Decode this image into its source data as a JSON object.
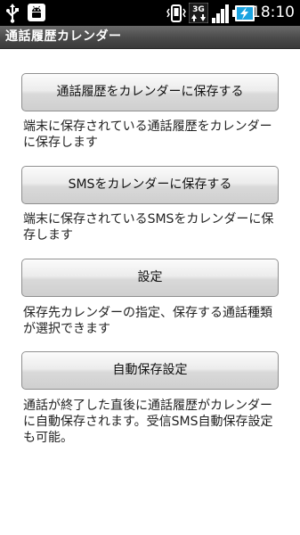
{
  "status_bar": {
    "time": "18:10",
    "network_label": "3G",
    "icons": [
      "usb-icon",
      "android-debug-icon",
      "vibrate-icon",
      "network-3g-icon",
      "signal-icon",
      "battery-charging-icon"
    ]
  },
  "app": {
    "title": "通話履歴カレンダー"
  },
  "main": {
    "items": [
      {
        "button_label": "通話履歴をカレンダーに保存する",
        "description": "端末に保存されている通話履歴をカレンダーに保存します"
      },
      {
        "button_label": "SMSをカレンダーに保存する",
        "description": "端末に保存されているSMSをカレンダーに保存します"
      },
      {
        "button_label": "設定",
        "description": "保存先カレンダーの指定、保存する通話種類が選択できます"
      },
      {
        "button_label": "自動保存設定",
        "description": "通話が終了した直後に通話履歴がカレンダーに自動保存されます。受信SMS自動保存設定も可能。"
      }
    ]
  }
}
